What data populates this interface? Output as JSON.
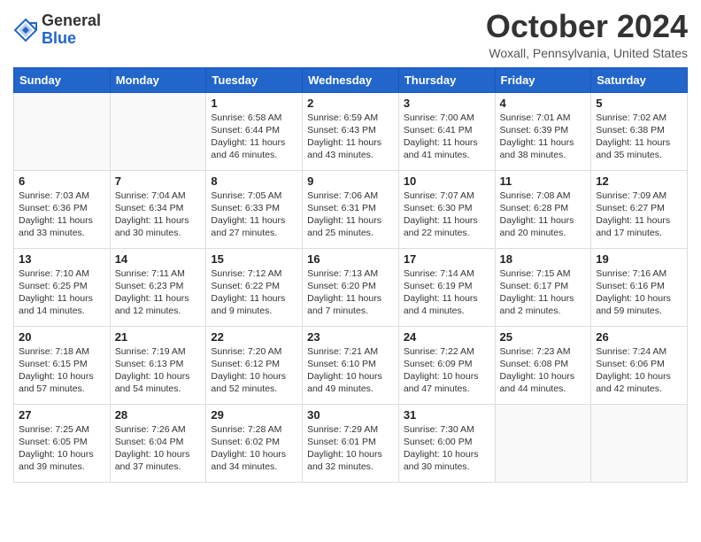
{
  "header": {
    "logo_line1": "General",
    "logo_line2": "Blue",
    "month_title": "October 2024",
    "location": "Woxall, Pennsylvania, United States"
  },
  "weekdays": [
    "Sunday",
    "Monday",
    "Tuesday",
    "Wednesday",
    "Thursday",
    "Friday",
    "Saturday"
  ],
  "weeks": [
    [
      {
        "day": "",
        "info": ""
      },
      {
        "day": "",
        "info": ""
      },
      {
        "day": "1",
        "info": "Sunrise: 6:58 AM\nSunset: 6:44 PM\nDaylight: 11 hours and 46 minutes."
      },
      {
        "day": "2",
        "info": "Sunrise: 6:59 AM\nSunset: 6:43 PM\nDaylight: 11 hours and 43 minutes."
      },
      {
        "day": "3",
        "info": "Sunrise: 7:00 AM\nSunset: 6:41 PM\nDaylight: 11 hours and 41 minutes."
      },
      {
        "day": "4",
        "info": "Sunrise: 7:01 AM\nSunset: 6:39 PM\nDaylight: 11 hours and 38 minutes."
      },
      {
        "day": "5",
        "info": "Sunrise: 7:02 AM\nSunset: 6:38 PM\nDaylight: 11 hours and 35 minutes."
      }
    ],
    [
      {
        "day": "6",
        "info": "Sunrise: 7:03 AM\nSunset: 6:36 PM\nDaylight: 11 hours and 33 minutes."
      },
      {
        "day": "7",
        "info": "Sunrise: 7:04 AM\nSunset: 6:34 PM\nDaylight: 11 hours and 30 minutes."
      },
      {
        "day": "8",
        "info": "Sunrise: 7:05 AM\nSunset: 6:33 PM\nDaylight: 11 hours and 27 minutes."
      },
      {
        "day": "9",
        "info": "Sunrise: 7:06 AM\nSunset: 6:31 PM\nDaylight: 11 hours and 25 minutes."
      },
      {
        "day": "10",
        "info": "Sunrise: 7:07 AM\nSunset: 6:30 PM\nDaylight: 11 hours and 22 minutes."
      },
      {
        "day": "11",
        "info": "Sunrise: 7:08 AM\nSunset: 6:28 PM\nDaylight: 11 hours and 20 minutes."
      },
      {
        "day": "12",
        "info": "Sunrise: 7:09 AM\nSunset: 6:27 PM\nDaylight: 11 hours and 17 minutes."
      }
    ],
    [
      {
        "day": "13",
        "info": "Sunrise: 7:10 AM\nSunset: 6:25 PM\nDaylight: 11 hours and 14 minutes."
      },
      {
        "day": "14",
        "info": "Sunrise: 7:11 AM\nSunset: 6:23 PM\nDaylight: 11 hours and 12 minutes."
      },
      {
        "day": "15",
        "info": "Sunrise: 7:12 AM\nSunset: 6:22 PM\nDaylight: 11 hours and 9 minutes."
      },
      {
        "day": "16",
        "info": "Sunrise: 7:13 AM\nSunset: 6:20 PM\nDaylight: 11 hours and 7 minutes."
      },
      {
        "day": "17",
        "info": "Sunrise: 7:14 AM\nSunset: 6:19 PM\nDaylight: 11 hours and 4 minutes."
      },
      {
        "day": "18",
        "info": "Sunrise: 7:15 AM\nSunset: 6:17 PM\nDaylight: 11 hours and 2 minutes."
      },
      {
        "day": "19",
        "info": "Sunrise: 7:16 AM\nSunset: 6:16 PM\nDaylight: 10 hours and 59 minutes."
      }
    ],
    [
      {
        "day": "20",
        "info": "Sunrise: 7:18 AM\nSunset: 6:15 PM\nDaylight: 10 hours and 57 minutes."
      },
      {
        "day": "21",
        "info": "Sunrise: 7:19 AM\nSunset: 6:13 PM\nDaylight: 10 hours and 54 minutes."
      },
      {
        "day": "22",
        "info": "Sunrise: 7:20 AM\nSunset: 6:12 PM\nDaylight: 10 hours and 52 minutes."
      },
      {
        "day": "23",
        "info": "Sunrise: 7:21 AM\nSunset: 6:10 PM\nDaylight: 10 hours and 49 minutes."
      },
      {
        "day": "24",
        "info": "Sunrise: 7:22 AM\nSunset: 6:09 PM\nDaylight: 10 hours and 47 minutes."
      },
      {
        "day": "25",
        "info": "Sunrise: 7:23 AM\nSunset: 6:08 PM\nDaylight: 10 hours and 44 minutes."
      },
      {
        "day": "26",
        "info": "Sunrise: 7:24 AM\nSunset: 6:06 PM\nDaylight: 10 hours and 42 minutes."
      }
    ],
    [
      {
        "day": "27",
        "info": "Sunrise: 7:25 AM\nSunset: 6:05 PM\nDaylight: 10 hours and 39 minutes."
      },
      {
        "day": "28",
        "info": "Sunrise: 7:26 AM\nSunset: 6:04 PM\nDaylight: 10 hours and 37 minutes."
      },
      {
        "day": "29",
        "info": "Sunrise: 7:28 AM\nSunset: 6:02 PM\nDaylight: 10 hours and 34 minutes."
      },
      {
        "day": "30",
        "info": "Sunrise: 7:29 AM\nSunset: 6:01 PM\nDaylight: 10 hours and 32 minutes."
      },
      {
        "day": "31",
        "info": "Sunrise: 7:30 AM\nSunset: 6:00 PM\nDaylight: 10 hours and 30 minutes."
      },
      {
        "day": "",
        "info": ""
      },
      {
        "day": "",
        "info": ""
      }
    ]
  ]
}
